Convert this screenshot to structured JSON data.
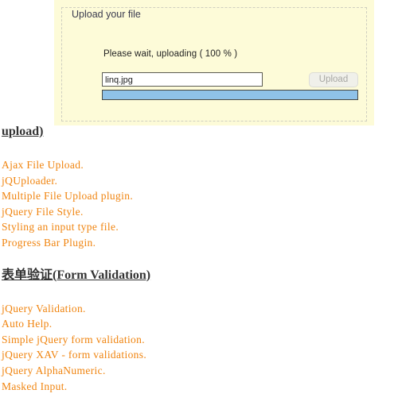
{
  "upload_widget": {
    "legend": "Upload your file",
    "status_text": "Please wait, uploading  ( 100 % )",
    "file_input_value": "linq.jpg",
    "file_input_placeholder": "",
    "upload_button_label": "Upload",
    "progress_percent": 100,
    "progress_fill_color": "#8fc2e8",
    "panel_background_color": "#fdfbd8"
  },
  "content": {
    "heading_upload": "upload)",
    "upload_list": [
      "Ajax File Upload.",
      "jQUploader.",
      "Multiple File Upload plugin.",
      "jQuery File Style.",
      "Styling an input type file.",
      "Progress Bar Plugin."
    ],
    "heading_validation": "表单验证(Form Validation)",
    "validation_list": [
      "jQuery Validation.",
      "Auto Help.",
      "Simple jQuery form validation.",
      "jQuery XAV - form validations.",
      "jQuery AlphaNumeric.",
      "Masked Input."
    ],
    "link_color": "#f0840f",
    "heading_color": "#333333"
  }
}
